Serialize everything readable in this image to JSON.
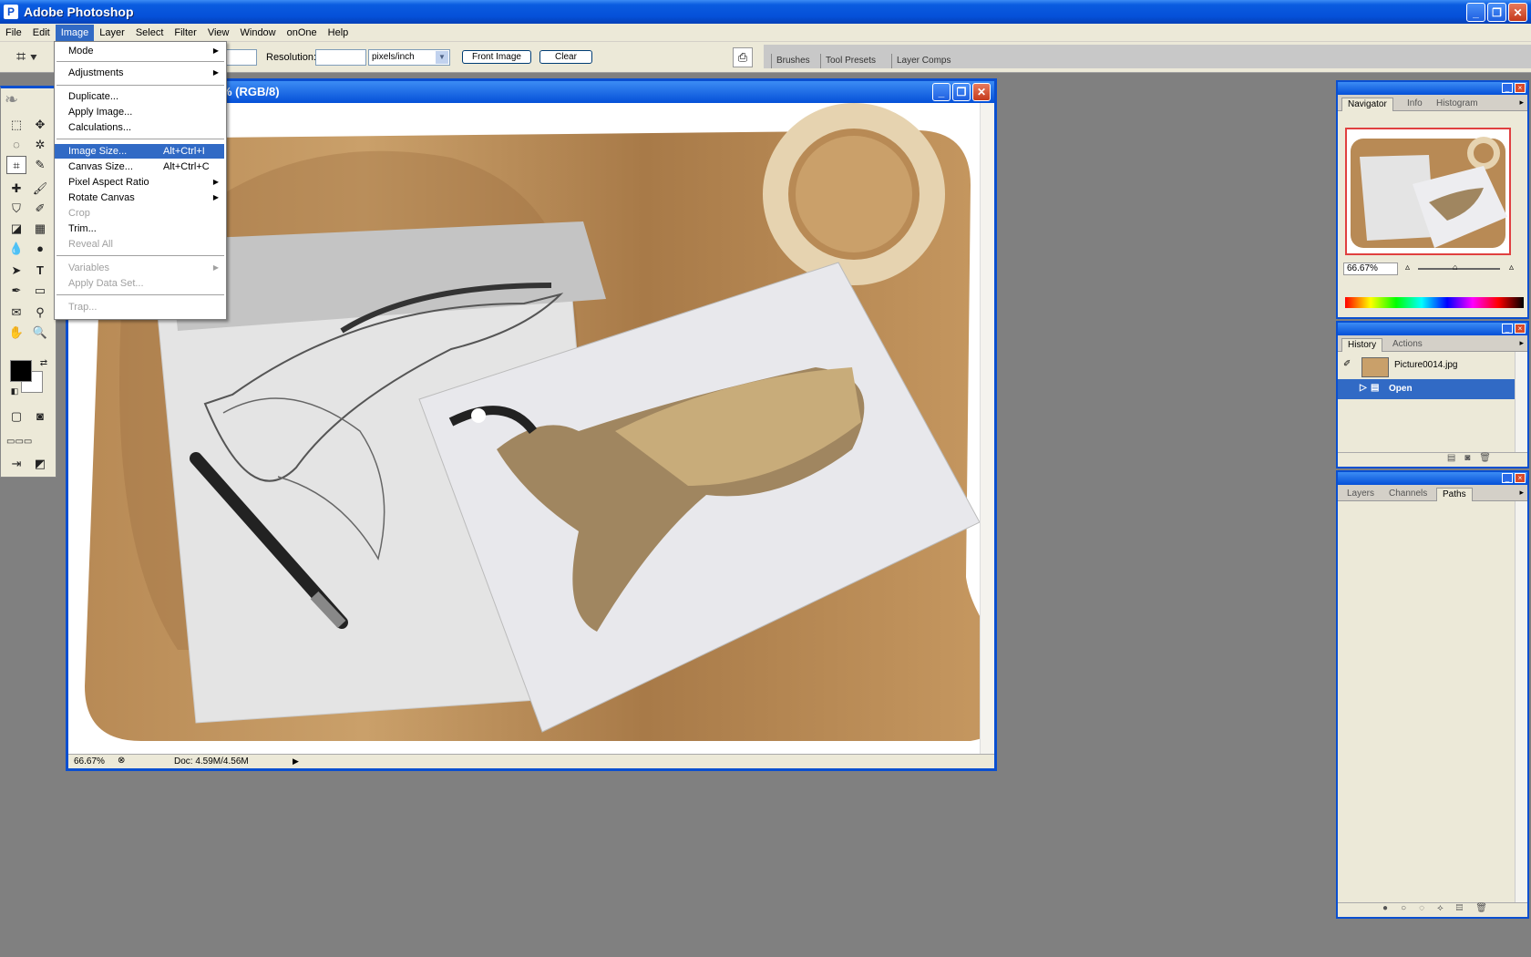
{
  "window": {
    "title": "Adobe Photoshop",
    "controls": {
      "minimize": "_",
      "maximize": "❐",
      "close": "✕"
    }
  },
  "menubar": [
    "File",
    "Edit",
    "Image",
    "Layer",
    "Select",
    "Filter",
    "View",
    "Window",
    "onOne",
    "Help"
  ],
  "options_bar": {
    "resolution_label": "Resolution:",
    "resolution_value": "",
    "units": "pixels/inch",
    "front_image": "Front Image",
    "clear": "Clear"
  },
  "palette_well": {
    "tabs": [
      "Brushes",
      "Tool Presets",
      "Layer Comps"
    ]
  },
  "image_menu": {
    "items": [
      {
        "label": "Mode",
        "submenu": true
      },
      {
        "label": "Adjustments",
        "submenu": true
      },
      {
        "label": "Duplicate..."
      },
      {
        "label": "Apply Image..."
      },
      {
        "label": "Calculations..."
      },
      {
        "label": "Image Size...",
        "shortcut": "Alt+Ctrl+I"
      },
      {
        "label": "Canvas Size...",
        "shortcut": "Alt+Ctrl+C"
      },
      {
        "label": "Pixel Aspect Ratio",
        "submenu": true
      },
      {
        "label": "Rotate Canvas",
        "submenu": true
      },
      {
        "label": "Crop"
      },
      {
        "label": "Trim..."
      },
      {
        "label": "Reveal All"
      },
      {
        "label": "Variables",
        "submenu": true
      },
      {
        "label": "Apply Data Set..."
      },
      {
        "label": "Trap..."
      }
    ],
    "highlighted": "Image Size..."
  },
  "document": {
    "title": "% (RGB/8)",
    "zoom": "66.67%",
    "doc_size": "Doc: 4.59M/4.56M"
  },
  "navigator": {
    "tabs": [
      "Navigator",
      "Info",
      "Histogram"
    ],
    "zoom": "66.67%"
  },
  "history": {
    "tabs": [
      "History",
      "Actions"
    ],
    "snapshot": "Picture0014.jpg",
    "state": "Open"
  },
  "layers": {
    "tabs": [
      "Layers",
      "Channels",
      "Paths"
    ]
  },
  "colors": {
    "accent": "#0a4fd0",
    "highlight": "#316ac5",
    "workspace": "#808080"
  }
}
